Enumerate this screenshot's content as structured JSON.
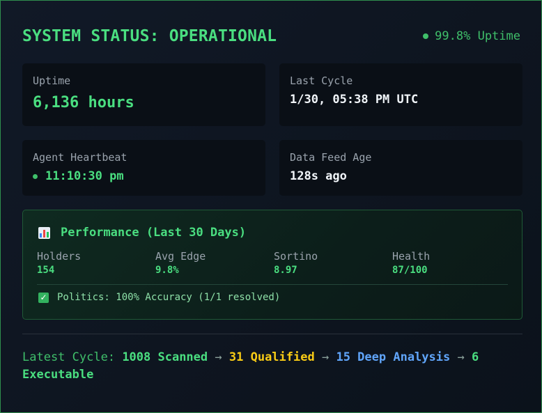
{
  "header": {
    "title": "SYSTEM STATUS: OPERATIONAL",
    "uptime_badge": "99.8% Uptime"
  },
  "cards": {
    "uptime": {
      "label": "Uptime",
      "value": "6,136 hours"
    },
    "last_cycle": {
      "label": "Last Cycle",
      "value": "1/30, 05:38 PM UTC"
    },
    "heartbeat": {
      "label": "Agent Heartbeat",
      "value": "11:10:30 pm"
    },
    "data_feed": {
      "label": "Data Feed Age",
      "value": "128s ago"
    }
  },
  "performance": {
    "title": "Performance (Last 30 Days)",
    "icon": "bar-chart-icon",
    "stats": [
      {
        "label": "Holders",
        "value": "154"
      },
      {
        "label": "Avg Edge",
        "value": "9.8%"
      },
      {
        "label": "Sortino",
        "value": "8.97"
      },
      {
        "label": "Health",
        "value": "87/100"
      }
    ],
    "note": "Politics: 100% Accuracy (1/1 resolved)",
    "note_icon": "check-icon"
  },
  "cycle": {
    "prefix": "Latest Cycle:",
    "scanned": "1008 Scanned",
    "qualified": "31 Qualified",
    "deep": "15 Deep Analysis",
    "executable": "6 Executable",
    "arrow": "→"
  },
  "colors": {
    "accent_green": "#4ade80",
    "border_green": "#2f8f4e",
    "yellow": "#facc15",
    "blue": "#60a5fa",
    "background": "#0d1219"
  }
}
